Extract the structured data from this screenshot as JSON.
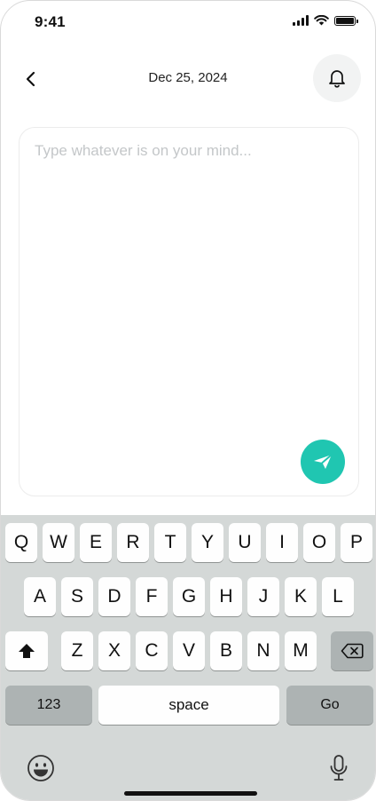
{
  "status_bar": {
    "time": "9:41",
    "icons": [
      "cellular-signal-icon",
      "wifi-icon",
      "battery-icon"
    ]
  },
  "header": {
    "back_icon": "chevron-left-icon",
    "title": "Dec 25, 2024",
    "notification_icon": "bell-icon"
  },
  "entry": {
    "placeholder": "Type whatever is on your mind...",
    "value": "",
    "send_icon": "send-icon"
  },
  "keyboard": {
    "row1": [
      "Q",
      "W",
      "E",
      "R",
      "T",
      "Y",
      "U",
      "I",
      "O",
      "P"
    ],
    "row2": [
      "A",
      "S",
      "D",
      "F",
      "G",
      "H",
      "J",
      "K",
      "L"
    ],
    "row3": [
      "Z",
      "X",
      "C",
      "V",
      "B",
      "N",
      "M"
    ],
    "shift_icon": "shift-icon",
    "delete_icon": "backspace-icon",
    "numbers_label": "123",
    "space_label": "space",
    "go_label": "Go",
    "emoji_icon": "emoji-icon",
    "mic_icon": "microphone-icon"
  },
  "colors": {
    "accent": "#20c6b1",
    "keyboard_bg": "#d4d8d7",
    "function_key": "#adb3b3"
  }
}
